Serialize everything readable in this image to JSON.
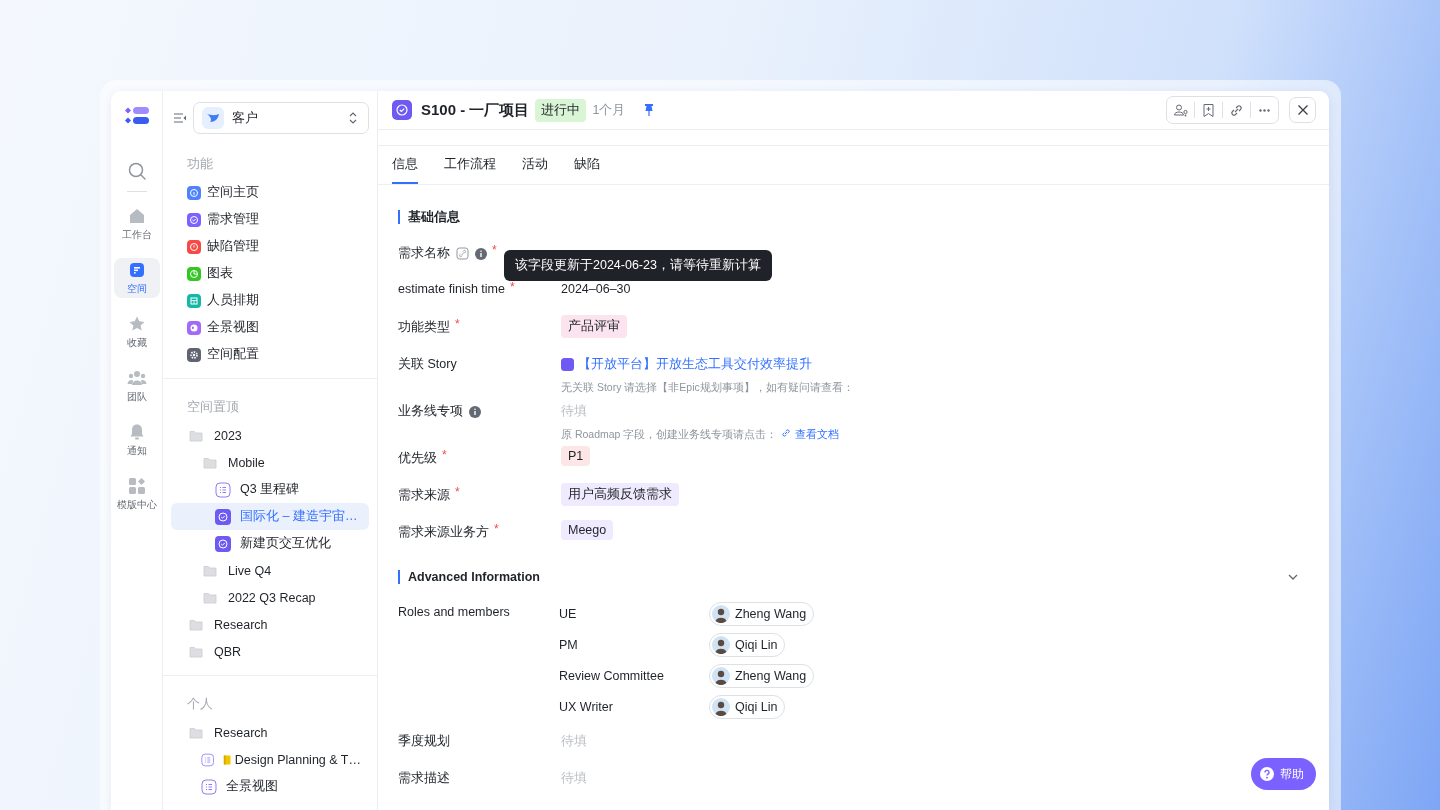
{
  "rail": {
    "items": [
      {
        "kind": "search",
        "selected": false
      },
      {
        "kind": "home",
        "label": "工作台",
        "selected": false
      },
      {
        "kind": "space",
        "label": "空间",
        "selected": true
      },
      {
        "kind": "star",
        "label": "收藏",
        "selected": false
      },
      {
        "kind": "team",
        "label": "团队",
        "selected": false
      },
      {
        "kind": "bell",
        "label": "通知",
        "selected": false
      },
      {
        "kind": "grid",
        "label": "模版中心",
        "selected": false
      }
    ]
  },
  "sidebar": {
    "space": "客户",
    "features": {
      "title": "功能",
      "items": [
        {
          "kind": "info",
          "label": "空间主页",
          "color": "#4e83fd"
        },
        {
          "kind": "check",
          "label": "需求管理",
          "color": "#7b61ff"
        },
        {
          "kind": "alert",
          "label": "缺陷管理",
          "color": "#f54a45"
        },
        {
          "kind": "chart",
          "label": "图表",
          "color": "#34c724"
        },
        {
          "kind": "calendar",
          "label": "人员排期",
          "color": "#14b8a6"
        },
        {
          "kind": "globe",
          "label": "全景视图",
          "color": "#a26af7"
        },
        {
          "kind": "gear",
          "label": "空间配置",
          "color": "#5f6470"
        }
      ]
    },
    "pinned": {
      "title": "空间置顶",
      "items": [
        {
          "kind": "folder",
          "label": "2023",
          "selected": false,
          "children": [
            {
              "kind": "folder",
              "label": "Mobile",
              "selected": false,
              "children": [
                {
                  "kind": "list",
                  "label": "Q3 里程碑",
                  "selected": false
                },
                {
                  "kind": "story",
                  "label": "国际化 – 建造宇宙…",
                  "selected": true
                },
                {
                  "kind": "story",
                  "label": "新建页交互优化",
                  "selected": false
                }
              ]
            },
            {
              "kind": "folder",
              "label": "Live Q4",
              "selected": false
            },
            {
              "kind": "folder",
              "label": "2022 Q3 Recap",
              "selected": false
            }
          ]
        },
        {
          "kind": "folder",
          "label": "Research",
          "selected": false
        },
        {
          "kind": "folder",
          "label": "QBR",
          "selected": false
        }
      ]
    },
    "personal": {
      "title": "个人",
      "items": [
        {
          "kind": "folder",
          "label": "Research",
          "selected": false,
          "children": [
            {
              "kind": "list",
              "label": "Design Planning & T…",
              "selected": false,
              "color": "#f5c400"
            },
            {
              "kind": "list",
              "label": "全景视图",
              "selected": false
            }
          ]
        }
      ]
    }
  },
  "header": {
    "title": "S100 - 一厂项目",
    "status": "进行中",
    "age": "1个月",
    "pinned": true
  },
  "tabs": [
    {
      "label": "信息",
      "selected": true
    },
    {
      "label": "工作流程",
      "selected": false
    },
    {
      "label": "活动",
      "selected": false
    },
    {
      "label": "缺陷",
      "selected": false
    }
  ],
  "basic": {
    "title": "基础信息",
    "fields": [
      {
        "kind": "text",
        "label": "需求名称",
        "required_mark": "*",
        "edit_icon": true,
        "info_icon": true
      },
      {
        "kind": "text",
        "label": "estimate finish time",
        "required_mark": "*",
        "value": "2024–06–30"
      },
      {
        "kind": "tag",
        "label": "功能类型",
        "required_mark": "*",
        "value": "产品评审",
        "color": "#fce4ef"
      },
      {
        "kind": "link",
        "label": "关联 Story",
        "value": "【开放平台】开放生态工具交付效率提升",
        "hint": "无关联 Story 请选择【非Epic规划事项】，如有疑问请查看："
      },
      {
        "kind": "empty",
        "label": "业务线专项",
        "info_icon": true,
        "placeholder": "待填",
        "hint": "原 Roadmap 字段，创建业务线专项请点击：",
        "hint_link": "查看文档"
      },
      {
        "kind": "tag",
        "label": "优先级",
        "required_mark": "*",
        "value": "P1",
        "color": "#fde6e6"
      },
      {
        "kind": "tag",
        "label": "需求来源",
        "required_mark": "*",
        "value": "用户高频反馈需求",
        "color": "#efeafd"
      },
      {
        "kind": "tag",
        "label": "需求来源业务方",
        "required_mark": "*",
        "value": "Meego",
        "color": "#efeafd"
      }
    ]
  },
  "tooltip": "该字段更新于2024-06-23，请等待重新计算",
  "advanced": {
    "title": "Advanced Information",
    "expanded": true,
    "roles_label": "Roles and members",
    "roles": [
      {
        "role": "UE",
        "member": "Zheng Wang"
      },
      {
        "role": "PM",
        "member": "Qiqi Lin"
      },
      {
        "role": "Review Committee",
        "member": "Zheng Wang"
      },
      {
        "role": "UX Writer",
        "member": "Qiqi Lin"
      }
    ],
    "fields": [
      {
        "kind": "empty",
        "label": "季度规划",
        "placeholder": "待填"
      },
      {
        "kind": "empty",
        "label": "需求描述",
        "placeholder": "待填"
      }
    ]
  },
  "help": "帮助"
}
